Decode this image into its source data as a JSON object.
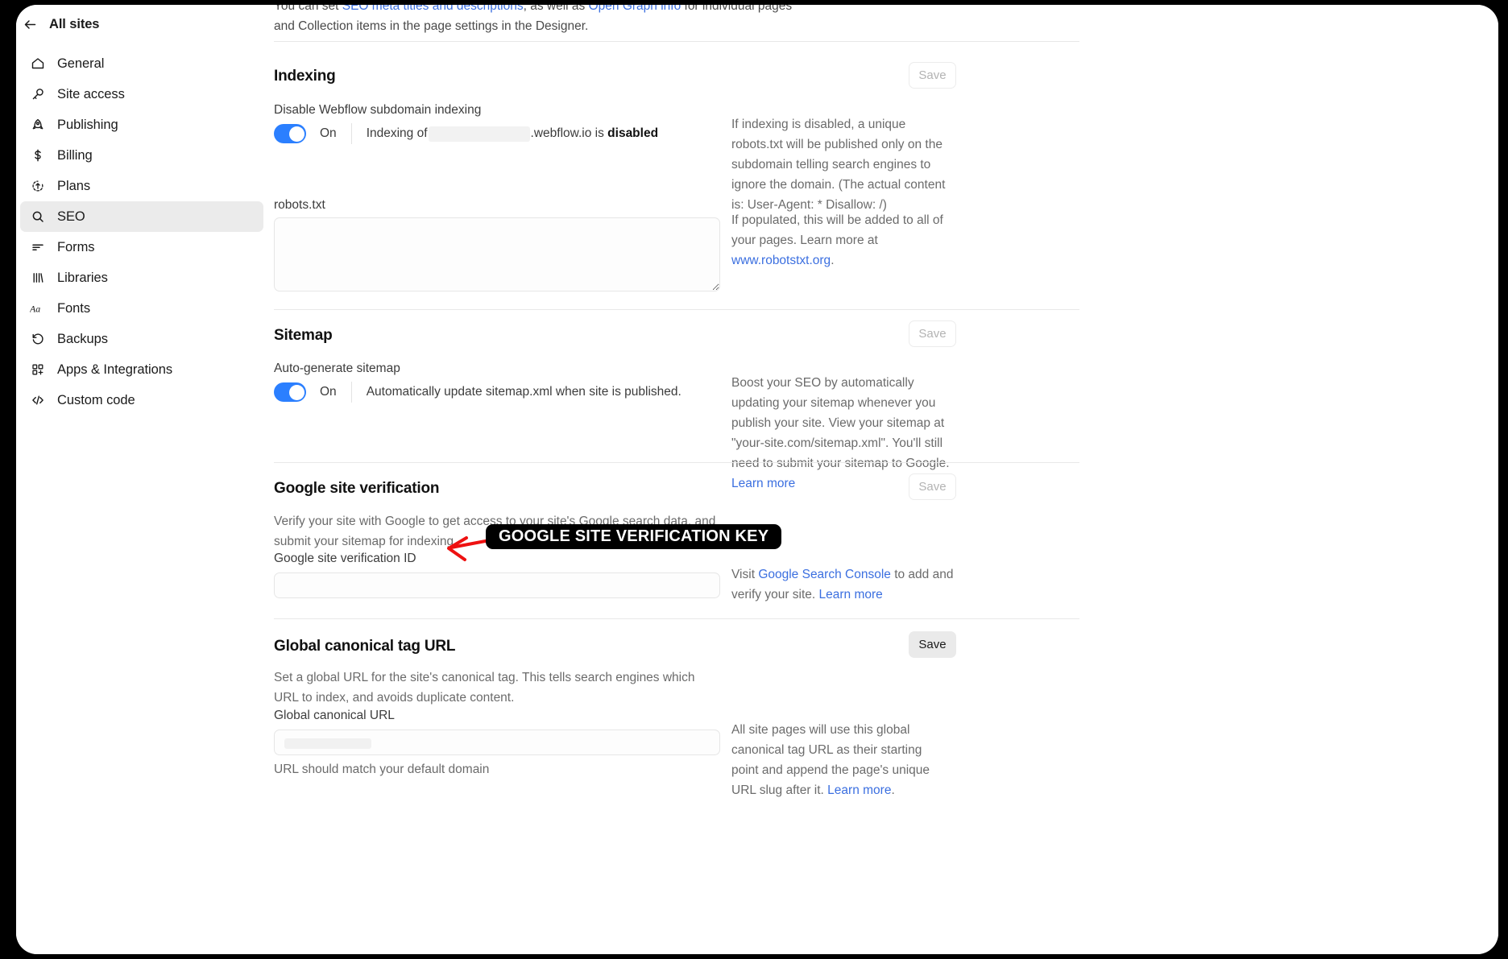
{
  "sidebar": {
    "back_label": "All sites",
    "items": [
      {
        "label": "General",
        "icon": "home-icon"
      },
      {
        "label": "Site access",
        "icon": "key-icon"
      },
      {
        "label": "Publishing",
        "icon": "rocket-icon"
      },
      {
        "label": "Billing",
        "icon": "dollar-icon"
      },
      {
        "label": "Plans",
        "icon": "upgrade-icon"
      },
      {
        "label": "SEO",
        "icon": "search-icon"
      },
      {
        "label": "Forms",
        "icon": "forms-icon"
      },
      {
        "label": "Libraries",
        "icon": "libraries-icon"
      },
      {
        "label": "Fonts",
        "icon": "fonts-icon"
      },
      {
        "label": "Backups",
        "icon": "backup-icon"
      },
      {
        "label": "Apps & Integrations",
        "icon": "apps-icon"
      },
      {
        "label": "Custom code",
        "icon": "code-icon"
      }
    ],
    "active": "SEO"
  },
  "intro": {
    "line1_a": "You can set ",
    "link1": "SEO meta titles and descriptions",
    "line1_b": ", as well as ",
    "link2": "Open Graph info",
    "line1_c": " for individual pages",
    "line2": "and Collection items in the page settings in the Designer."
  },
  "indexing": {
    "title": "Indexing",
    "save_label": "Save",
    "toggle_label": "Disable Webflow subdomain indexing",
    "toggle_state": "On",
    "toggle_text_prefix": "Indexing of",
    "toggle_text_domain": ".webflow.io is",
    "toggle_text_bold": "disabled",
    "helper": "If indexing is disabled, a unique robots.txt will be published only on the subdomain telling search engines to ignore the domain. (The actual content is: User-Agent: * Disallow: /)",
    "robots_label": "robots.txt",
    "robots_value": "",
    "robots_placeholder": "",
    "robots_helper_a": "If populated, this will be added to all of your pages. Learn more at ",
    "robots_helper_link": "www.robotstxt.org",
    "robots_helper_b": "."
  },
  "sitemap": {
    "title": "Sitemap",
    "save_label": "Save",
    "toggle_label": "Auto-generate sitemap",
    "toggle_state": "On",
    "toggle_text": "Automatically update sitemap.xml when site is published.",
    "helper_a": "Boost your SEO by automatically updating your sitemap whenever you publish your site. View your sitemap at \"your-site.com/sitemap.xml\". You'll still need to submit your sitemap to Google. ",
    "helper_link": "Learn more"
  },
  "google_verification": {
    "title": "Google site verification",
    "save_label": "Save",
    "description": "Verify your site with Google to get access to your site's Google search data, and submit your sitemap for indexing.",
    "field_label": "Google site verification ID",
    "field_value": "",
    "field_placeholder": "",
    "helper_a": "Visit ",
    "helper_link1": "Google Search Console",
    "helper_b": " to add and verify your site. ",
    "helper_link2": "Learn more"
  },
  "canonical": {
    "title": "Global canonical tag URL",
    "save_label": "Save",
    "description": "Set a global URL for the site's canonical tag. This tells search engines which URL to index, and avoids duplicate content.",
    "field_label": "Global canonical URL",
    "field_value": "",
    "field_placeholder": "",
    "field_note": "URL should match your default domain",
    "helper_a": "All site pages will use this global canonical tag URL as their starting point and append the page's unique URL slug after it. ",
    "helper_link": "Learn more",
    "helper_b": "."
  },
  "annotation": {
    "callout_text": "GOOGLE SITE VERIFICATION KEY",
    "arrow_color": "#ee1111",
    "callout_bg": "#000000",
    "callout_fg": "#ffffff"
  },
  "colors": {
    "accent_blue": "#2b7fff",
    "link_blue": "#3b6fe0",
    "active_nav_bg": "#ebebeb",
    "save_enabled_bg": "#eaeaea"
  }
}
